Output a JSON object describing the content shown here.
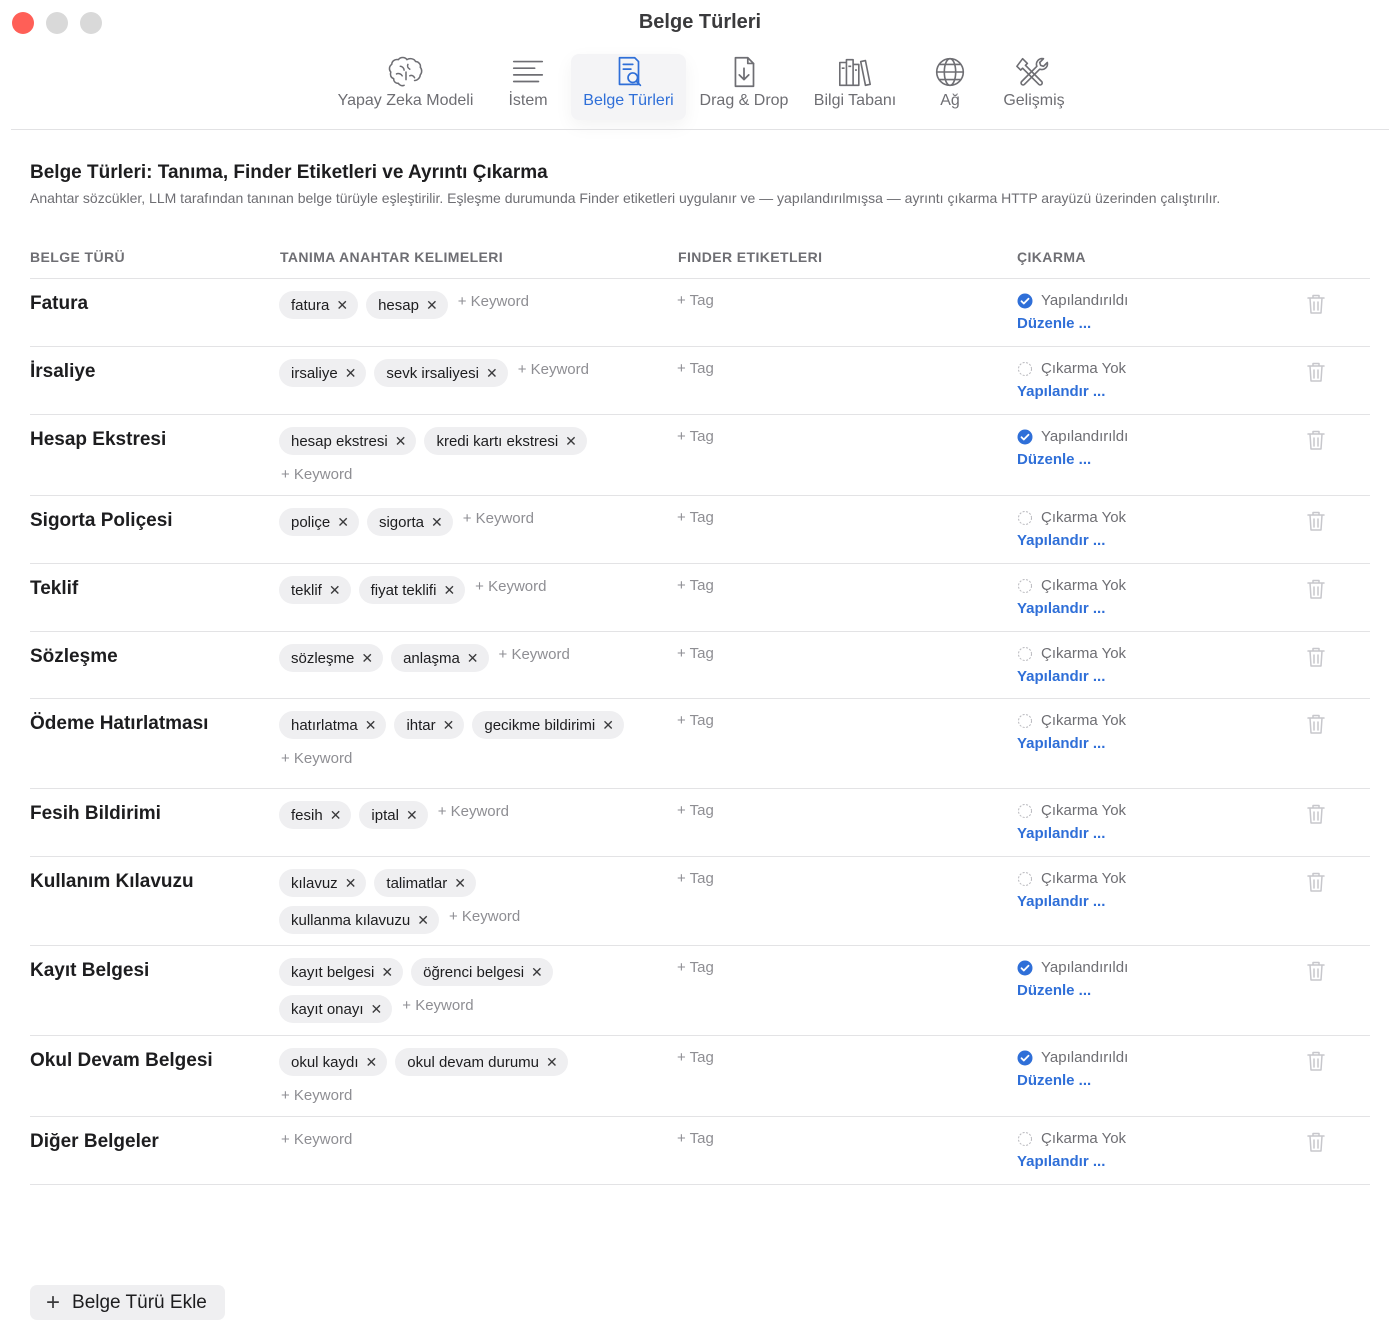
{
  "window": {
    "title": "Belge Türleri"
  },
  "toolbar": {
    "items": [
      {
        "label": "Yapay Zeka Modeli",
        "icon": "brain-icon",
        "active": false
      },
      {
        "label": "İstem",
        "icon": "text-lines-icon",
        "active": false
      },
      {
        "label": "Belge Türleri",
        "icon": "document-search-icon",
        "active": true
      },
      {
        "label": "Drag & Drop",
        "icon": "document-download-icon",
        "active": false
      },
      {
        "label": "Bilgi Tabanı",
        "icon": "books-icon",
        "active": false
      },
      {
        "label": "Ağ",
        "icon": "globe-icon",
        "active": false
      },
      {
        "label": "Gelişmiş",
        "icon": "tools-icon",
        "active": false
      }
    ]
  },
  "header": {
    "title": "Belge Türleri: Tanıma, Finder Etiketleri ve Ayrıntı Çıkarma",
    "description": "Anahtar sözcükler, LLM tarafından tanınan belge türüyle eşleştirilir. Eşleşme durumunda Finder etiketleri uygulanır ve — yapılandırılmışsa — ayrıntı çıkarma HTTP arayüzü üzerinden çalıştırılır."
  },
  "columns": {
    "type": "BELGE TÜRÜ",
    "keywords": "TANIMA ANAHTAR KELIMELERI",
    "tags": "FINDER ETIKETLERI",
    "extraction": "ÇIKARMA"
  },
  "labels": {
    "add_keyword": "+ Keyword",
    "add_tag": "+ Tag",
    "status_configured": "Yapılandırıldı",
    "status_none": "Çıkarma Yok",
    "link_edit": "Düzenle ...",
    "link_configure": "Yapılandır ..."
  },
  "colors": {
    "accent": "#2f6fd8",
    "close": "#ff5f57"
  },
  "rows": [
    {
      "name": "Fatura",
      "keywords": [
        "fatura",
        "hesap"
      ],
      "configured": true
    },
    {
      "name": "İrsaliye",
      "keywords": [
        "irsaliye",
        "sevk irsaliyesi"
      ],
      "configured": false
    },
    {
      "name": "Hesap Ekstresi",
      "keywords": [
        "hesap ekstresi",
        "kredi kartı ekstresi"
      ],
      "configured": true
    },
    {
      "name": "Sigorta Poliçesi",
      "keywords": [
        "poliçe",
        "sigorta"
      ],
      "configured": false
    },
    {
      "name": "Teklif",
      "keywords": [
        "teklif",
        "fiyat teklifi"
      ],
      "configured": false
    },
    {
      "name": "Sözleşme",
      "keywords": [
        "sözleşme",
        "anlaşma"
      ],
      "configured": false
    },
    {
      "name": "Ödeme Hatırlatması",
      "keywords": [
        "hatırlatma",
        "ihtar",
        "gecikme bildirimi"
      ],
      "configured": false
    },
    {
      "name": "Fesih Bildirimi",
      "keywords": [
        "fesih",
        "iptal"
      ],
      "configured": false
    },
    {
      "name": "Kullanım Kılavuzu",
      "keywords": [
        "kılavuz",
        "talimatlar",
        "kullanma kılavuzu"
      ],
      "configured": false
    },
    {
      "name": "Kayıt Belgesi",
      "keywords": [
        "kayıt belgesi",
        "öğrenci belgesi",
        "kayıt onayı"
      ],
      "configured": true
    },
    {
      "name": "Okul Devam Belgesi",
      "keywords": [
        "okul kaydı",
        "okul devam durumu"
      ],
      "configured": true
    },
    {
      "name": "Diğer Belgeler",
      "keywords": [],
      "configured": false
    }
  ],
  "footer": {
    "add_button": "Belge Türü Ekle"
  }
}
